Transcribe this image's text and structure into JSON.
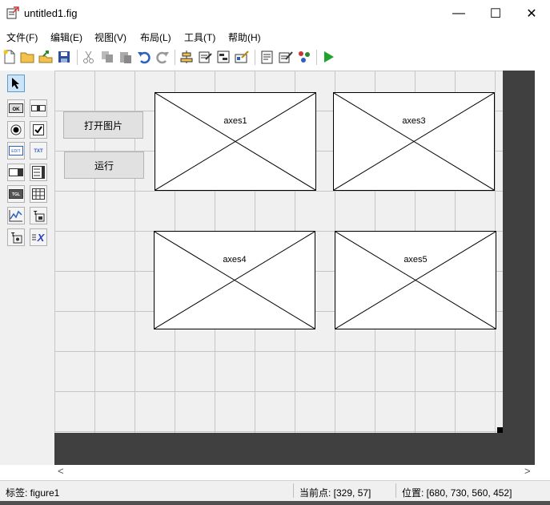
{
  "window": {
    "title": "untitled1.fig",
    "minimize": "—",
    "maximize": "☐",
    "close": "✕"
  },
  "menu": [
    "文件(F)",
    "编辑(E)",
    "视图(V)",
    "布局(L)",
    "工具(T)",
    "帮助(H)"
  ],
  "toolbar": {
    "icons": [
      "new-file-icon",
      "open-folder-icon",
      "export-icon",
      "save-icon",
      "cut-icon",
      "copy-icon",
      "paste-icon",
      "undo-icon",
      "redo-icon",
      "align-objects-icon",
      "menu-editor-icon",
      "tab-order-icon",
      "toolbar-editor-icon",
      "editor-icon",
      "property-inspector-icon",
      "object-browser-icon",
      "run-figure-icon"
    ]
  },
  "palette": {
    "tools": [
      {
        "name": "select-tool",
        "glyph": "↖",
        "active": true
      },
      {
        "name": "push-button-tool",
        "glyph": "OK"
      },
      {
        "name": "slider-tool",
        "glyph": "▭"
      },
      {
        "name": "radio-button-tool",
        "glyph": "◉"
      },
      {
        "name": "checkbox-tool",
        "glyph": "☑"
      },
      {
        "name": "edit-text-tool",
        "glyph": "EDIT"
      },
      {
        "name": "static-text-tool",
        "glyph": "TXT"
      },
      {
        "name": "popup-menu-tool",
        "glyph": "▭"
      },
      {
        "name": "listbox-tool",
        "glyph": "☰"
      },
      {
        "name": "toggle-button-tool",
        "glyph": "TGL"
      },
      {
        "name": "table-tool",
        "glyph": "▦"
      },
      {
        "name": "axes-tool",
        "glyph": "📈"
      },
      {
        "name": "panel-tool",
        "glyph": "T"
      },
      {
        "name": "button-group-tool",
        "glyph": "T"
      },
      {
        "name": "activex-tool",
        "glyph": "X"
      }
    ]
  },
  "canvas": {
    "buttons": [
      {
        "id": "open-image-button",
        "label": "打开图片"
      },
      {
        "id": "run-button",
        "label": "运行"
      }
    ],
    "axes": [
      "axes1",
      "axes3",
      "axes4",
      "axes5"
    ]
  },
  "scroll": {
    "left_arrow": "<",
    "right_arrow": ">"
  },
  "status": {
    "tag_label": "标签: figure1",
    "current_point": "当前点:  [329, 57]",
    "position": "位置: [680, 730, 560, 452]"
  }
}
